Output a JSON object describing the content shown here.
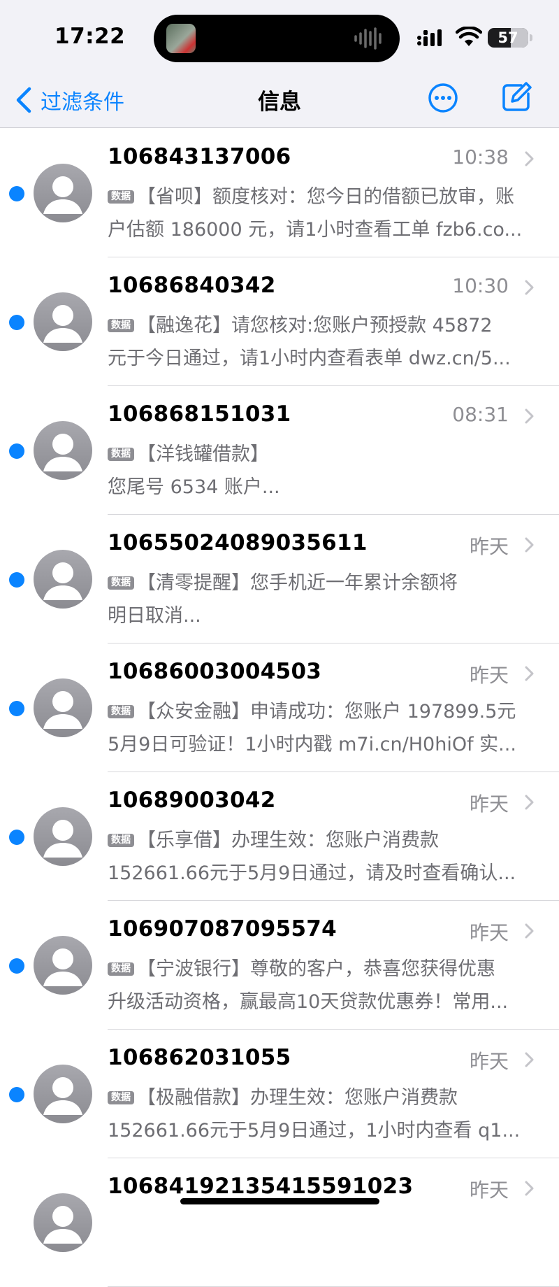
{
  "status_bar": {
    "time": "17:22",
    "battery": "57",
    "battery_level": 0.57
  },
  "nav": {
    "back_label": "过滤条件",
    "title": "信息"
  },
  "messages": [
    {
      "sender": "106843137006",
      "time": "10:38",
      "badge": "数据",
      "line1": "【省呗】额度核对：您今日的借额已放审，账",
      "line2": "户估额 186000 元，请1小时查看工单 fzb6.co...",
      "unread": true
    },
    {
      "sender": "10686840342",
      "time": "10:30",
      "badge": "数据",
      "line1": "【融逸花】请您核对:您账户预授款 45872",
      "line2": "元于今日通过，请1小时内查看表单 dwz.cn/5...",
      "unread": true
    },
    {
      "sender": "106868151031",
      "time": "08:31",
      "badge": "数据",
      "line1": "【洋钱罐借款】",
      "line2": "您尾号 6534 账户...",
      "unread": true
    },
    {
      "sender": "10655024089035611",
      "time": "昨天",
      "badge": "数据",
      "line1": "【清零提醒】您手机近一年累计余额将",
      "line2": "明日取消...",
      "unread": true
    },
    {
      "sender": "10686003004503",
      "time": "昨天",
      "badge": "数据",
      "line1": "【众安金融】申请成功：您账户 197899.5元",
      "line2": "5月9日可验证！1小时内戳 m7i.cn/H0hiOf 实...",
      "unread": true
    },
    {
      "sender": "10689003042",
      "time": "昨天",
      "badge": "数据",
      "line1": "【乐享借】办理生效：您账户消费款",
      "line2": "152661.66元于5月9日通过，请及时查看确认...",
      "unread": true
    },
    {
      "sender": "106907087095574",
      "time": "昨天",
      "badge": "数据",
      "line1": "【宁波银行】尊敬的客户，恭喜您获得优惠",
      "line2": "升级活动资格，赢最高10天贷款优惠券！常用...",
      "unread": true
    },
    {
      "sender": "106862031055",
      "time": "昨天",
      "badge": "数据",
      "line1": "【极融借款】办理生效：您账户消费款",
      "line2": "152661.66元于5月9日通过，1小时内查看 q1...",
      "unread": true
    },
    {
      "sender": "10684192135415591023",
      "time": "昨天",
      "badge": "",
      "line1": "",
      "line2": "",
      "unread": false
    }
  ]
}
